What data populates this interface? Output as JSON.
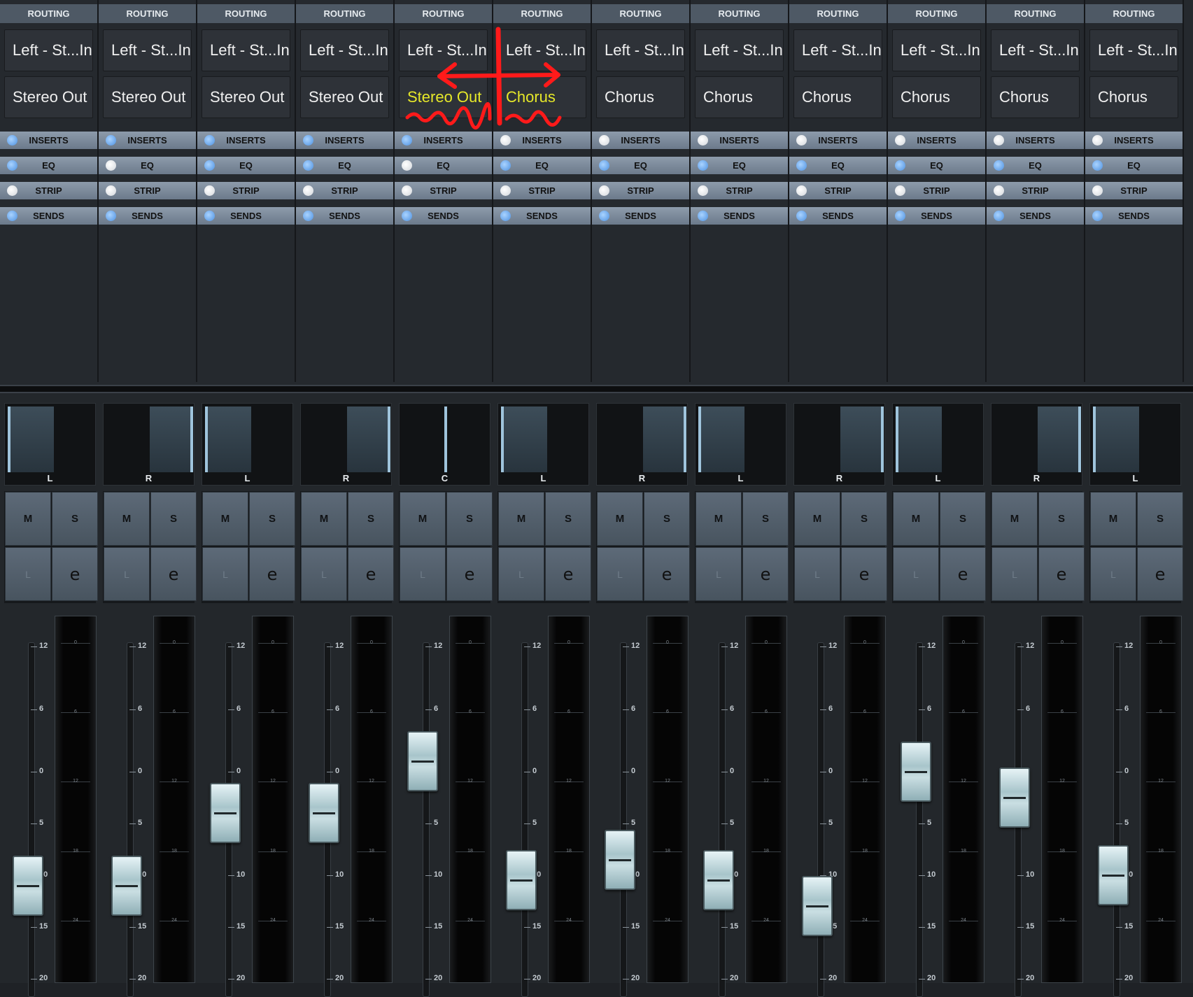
{
  "channels": [
    {
      "routing_label": "ROUTING",
      "input": "Left - St...In",
      "output": "Stereo Out",
      "inserts": "INSERTS",
      "eq": "EQ",
      "strip": "STRIP",
      "sends": "SENDS",
      "pan": "L",
      "mute": "M",
      "solo": "S",
      "listen": "L",
      "edit": "e",
      "fader_db": -11
    },
    {
      "routing_label": "ROUTING",
      "input": "Left - St...In",
      "output": "Stereo Out",
      "inserts": "INSERTS",
      "eq": "EQ",
      "strip": "STRIP",
      "sends": "SENDS",
      "pan": "R",
      "mute": "M",
      "solo": "S",
      "listen": "L",
      "edit": "e",
      "fader_db": -11
    },
    {
      "routing_label": "ROUTING",
      "input": "Left - St...In",
      "output": "Stereo Out",
      "inserts": "INSERTS",
      "eq": "EQ",
      "strip": "STRIP",
      "sends": "SENDS",
      "pan": "L",
      "mute": "M",
      "solo": "S",
      "listen": "L",
      "edit": "e",
      "fader_db": -4
    },
    {
      "routing_label": "ROUTING",
      "input": "Left - St...In",
      "output": "Stereo Out",
      "inserts": "INSERTS",
      "eq": "EQ",
      "strip": "STRIP",
      "sends": "SENDS",
      "pan": "R",
      "mute": "M",
      "solo": "S",
      "listen": "L",
      "edit": "e",
      "fader_db": -4
    },
    {
      "routing_label": "ROUTING",
      "input": "Left - St...In",
      "output": "Stereo Out",
      "inserts": "INSERTS",
      "eq": "EQ",
      "strip": "STRIP",
      "sends": "SENDS",
      "pan": "C",
      "mute": "M",
      "solo": "S",
      "listen": "L",
      "edit": "e",
      "fader_db": 1
    },
    {
      "routing_label": "ROUTING",
      "input": "Left - St...In",
      "output": "Chorus",
      "inserts": "INSERTS",
      "eq": "EQ",
      "strip": "STRIP",
      "sends": "SENDS",
      "pan": "L",
      "mute": "M",
      "solo": "S",
      "listen": "L",
      "edit": "e",
      "fader_db": -10.5
    },
    {
      "routing_label": "ROUTING",
      "input": "Left - St...In",
      "output": "Chorus",
      "inserts": "INSERTS",
      "eq": "EQ",
      "strip": "STRIP",
      "sends": "SENDS",
      "pan": "R",
      "mute": "M",
      "solo": "S",
      "listen": "L",
      "edit": "e",
      "fader_db": -8.5
    },
    {
      "routing_label": "ROUTING",
      "input": "Left - St...In",
      "output": "Chorus",
      "inserts": "INSERTS",
      "eq": "EQ",
      "strip": "STRIP",
      "sends": "SENDS",
      "pan": "L",
      "mute": "M",
      "solo": "S",
      "listen": "L",
      "edit": "e",
      "fader_db": -10.5
    },
    {
      "routing_label": "ROUTING",
      "input": "Left - St...In",
      "output": "Chorus",
      "inserts": "INSERTS",
      "eq": "EQ",
      "strip": "STRIP",
      "sends": "SENDS",
      "pan": "R",
      "mute": "M",
      "solo": "S",
      "listen": "L",
      "edit": "e",
      "fader_db": -13
    },
    {
      "routing_label": "ROUTING",
      "input": "Left - St...In",
      "output": "Chorus",
      "inserts": "INSERTS",
      "eq": "EQ",
      "strip": "STRIP",
      "sends": "SENDS",
      "pan": "L",
      "mute": "M",
      "solo": "S",
      "listen": "L",
      "edit": "e",
      "fader_db": 0
    },
    {
      "routing_label": "ROUTING",
      "input": "Left - St...In",
      "output": "Chorus",
      "inserts": "INSERTS",
      "eq": "EQ",
      "strip": "STRIP",
      "sends": "SENDS",
      "pan": "R",
      "mute": "M",
      "solo": "S",
      "listen": "L",
      "edit": "e",
      "fader_db": -2.5
    },
    {
      "routing_label": "ROUTING",
      "input": "Left - St...In",
      "output": "Chorus",
      "inserts": "INSERTS",
      "eq": "EQ",
      "strip": "STRIP",
      "sends": "SENDS",
      "pan": "L",
      "mute": "M",
      "solo": "S",
      "listen": "L",
      "edit": "e",
      "fader_db": -10
    }
  ],
  "highlighted_channels": [
    4,
    5
  ],
  "section_states": {
    "inserts_on": [
      true,
      true,
      true,
      true,
      true,
      false,
      false,
      false,
      false,
      false,
      false,
      false
    ],
    "eq_on": [
      true,
      false,
      true,
      true,
      false,
      true,
      true,
      true,
      true,
      true,
      true,
      true
    ],
    "strip_on": [
      false,
      false,
      false,
      false,
      false,
      false,
      false,
      false,
      false,
      false,
      false,
      false
    ],
    "sends_on": [
      true,
      true,
      true,
      true,
      true,
      true,
      true,
      true,
      true,
      true,
      true,
      true
    ]
  },
  "fader_scale": [
    "12",
    "6",
    "0",
    "5",
    "10",
    "15",
    "20"
  ],
  "meter_scale": [
    "0",
    "6",
    "12",
    "18",
    "24"
  ],
  "colors": {
    "accent_highlight": "#e6e829",
    "annotation": "#ff1a1a",
    "section_on": "#4e91e0",
    "section_off": "#ffffff"
  }
}
